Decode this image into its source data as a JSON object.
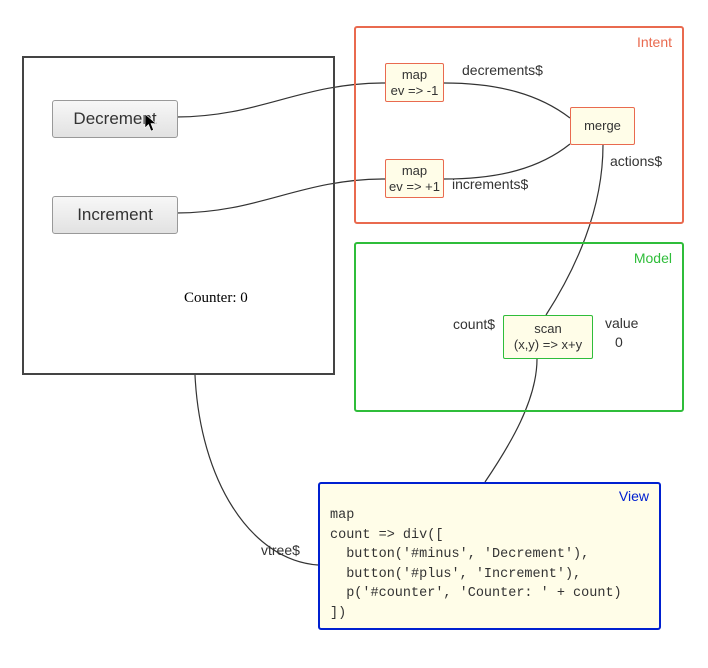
{
  "app": {
    "decrement_label": "Decrement",
    "increment_label": "Increment",
    "counter_text": "Counter: 0"
  },
  "intent": {
    "title": "Intent",
    "map_dec": {
      "op": "map",
      "fn": "ev => -1"
    },
    "map_inc": {
      "op": "map",
      "fn": "ev => +1"
    },
    "merge_label": "merge",
    "decrements_label": "decrements$",
    "increments_label": "increments$",
    "actions_label": "actions$"
  },
  "model": {
    "title": "Model",
    "scan": {
      "op": "scan",
      "fn": "(x,y) => x+y"
    },
    "count_label": "count$",
    "value_label": "value",
    "value_text": "0"
  },
  "view": {
    "title": "View",
    "vtree_label": "vtree$",
    "code": "map\ncount => div([\n  button('#minus', 'Decrement'),\n  button('#plus', 'Increment'),\n  p('#counter', 'Counter: ' + count)\n])"
  }
}
